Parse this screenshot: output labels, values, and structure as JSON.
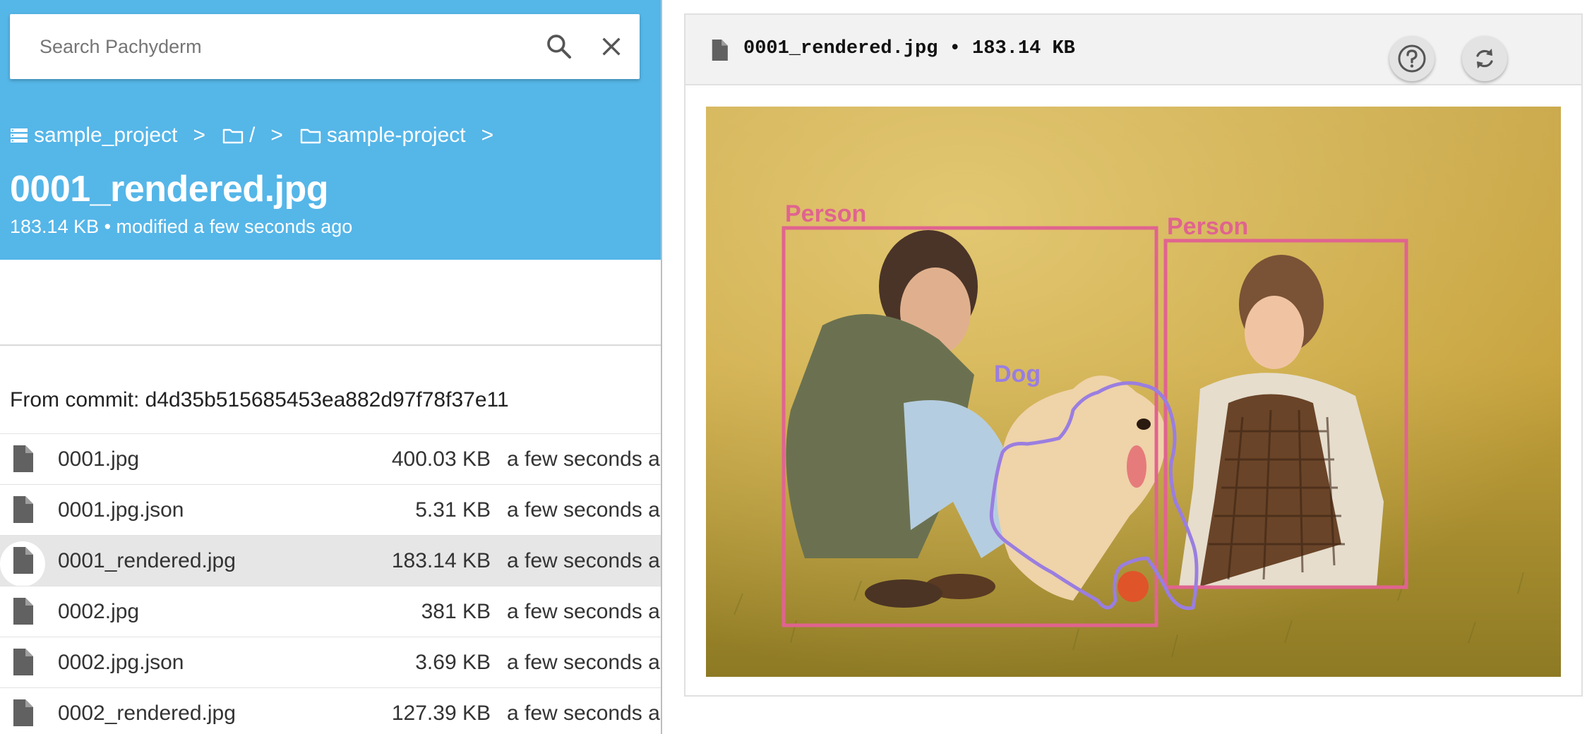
{
  "search": {
    "placeholder": "Search Pachyderm"
  },
  "breadcrumbs": [
    {
      "label": "sample_project",
      "icon": "database-icon"
    },
    {
      "label": "/",
      "icon": "folder-icon"
    },
    {
      "label": "sample-project",
      "icon": "folder-icon"
    }
  ],
  "breadcrumb_separator": ">",
  "file": {
    "title": "0001_rendered.jpg",
    "meta": "183.14 KB • modified a few seconds ago"
  },
  "commit_text": "From commit: d4d35b515685453ea882d97f78f37e11",
  "files": [
    {
      "name": "0001.jpg",
      "size": "400.03 KB",
      "modified": "a few seconds ago"
    },
    {
      "name": "0001.jpg.json",
      "size": "5.31 KB",
      "modified": "a few seconds ago"
    },
    {
      "name": "0001_rendered.jpg",
      "size": "183.14 KB",
      "modified": "a few seconds ago",
      "selected": true
    },
    {
      "name": "0002.jpg",
      "size": "381 KB",
      "modified": "a few seconds ago"
    },
    {
      "name": "0002.jpg.json",
      "size": "3.69 KB",
      "modified": "a few seconds ago"
    },
    {
      "name": "0002_rendered.jpg",
      "size": "127.39 KB",
      "modified": "a few seconds ago"
    }
  ],
  "viewer": {
    "title": "0001_rendered.jpg • 183.14 KB",
    "help_icon": "help-icon",
    "refresh_icon": "refresh-icon"
  },
  "detections": [
    {
      "label": "Person"
    },
    {
      "label": "Person"
    },
    {
      "label": "Dog"
    }
  ],
  "colors": {
    "accent": "#55b6e8",
    "person_box": "#e0648f",
    "dog_outline": "#9a7ee0"
  }
}
